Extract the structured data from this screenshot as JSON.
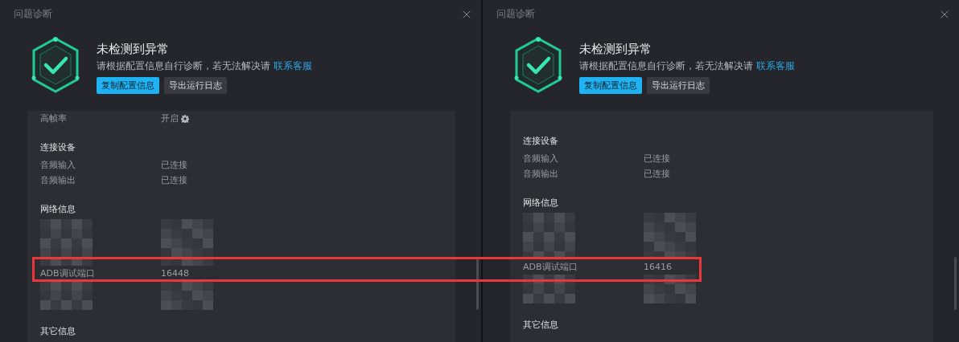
{
  "panels": [
    {
      "title": "问题诊断",
      "status_title": "未检测到异常",
      "message": "请根据配置信息自行诊断，若无法解决请",
      "link": "联系客服",
      "buttons": [
        {
          "label": "复制配置信息",
          "primary": true
        },
        {
          "label": "导出运行日志",
          "primary": false
        }
      ],
      "items": [
        {
          "kind": "row",
          "label": "高帧率",
          "value": "开启",
          "settings": true
        },
        {
          "kind": "heading",
          "text": "连接设备"
        },
        {
          "kind": "row",
          "label": "音频输入",
          "value": "已连接"
        },
        {
          "kind": "row",
          "label": "音频输出",
          "value": "已连接"
        },
        {
          "kind": "heading",
          "text": "网络信息"
        },
        {
          "kind": "redacted"
        },
        {
          "kind": "row",
          "label": "ADB调试端口",
          "value": "16448"
        },
        {
          "kind": "redacted"
        },
        {
          "kind": "heading",
          "text": "其它信息"
        }
      ]
    },
    {
      "title": "问题诊断",
      "status_title": "未检测到异常",
      "message": "请根据配置信息自行诊断，若无法解决请",
      "link": "联系客服",
      "buttons": [
        {
          "label": "复制配置信息",
          "primary": true
        },
        {
          "label": "导出运行日志",
          "primary": false
        }
      ],
      "items": [
        {
          "kind": "heading",
          "text": "连接设备"
        },
        {
          "kind": "row",
          "label": "音频输入",
          "value": "已连接"
        },
        {
          "kind": "row",
          "label": "音频输出",
          "value": "已连接"
        },
        {
          "kind": "heading",
          "text": "网络信息"
        },
        {
          "kind": "redacted"
        },
        {
          "kind": "row",
          "label": "ADB调试端口",
          "value": "16416"
        },
        {
          "kind": "redacted"
        },
        {
          "kind": "heading",
          "text": "其它信息"
        }
      ]
    }
  ]
}
